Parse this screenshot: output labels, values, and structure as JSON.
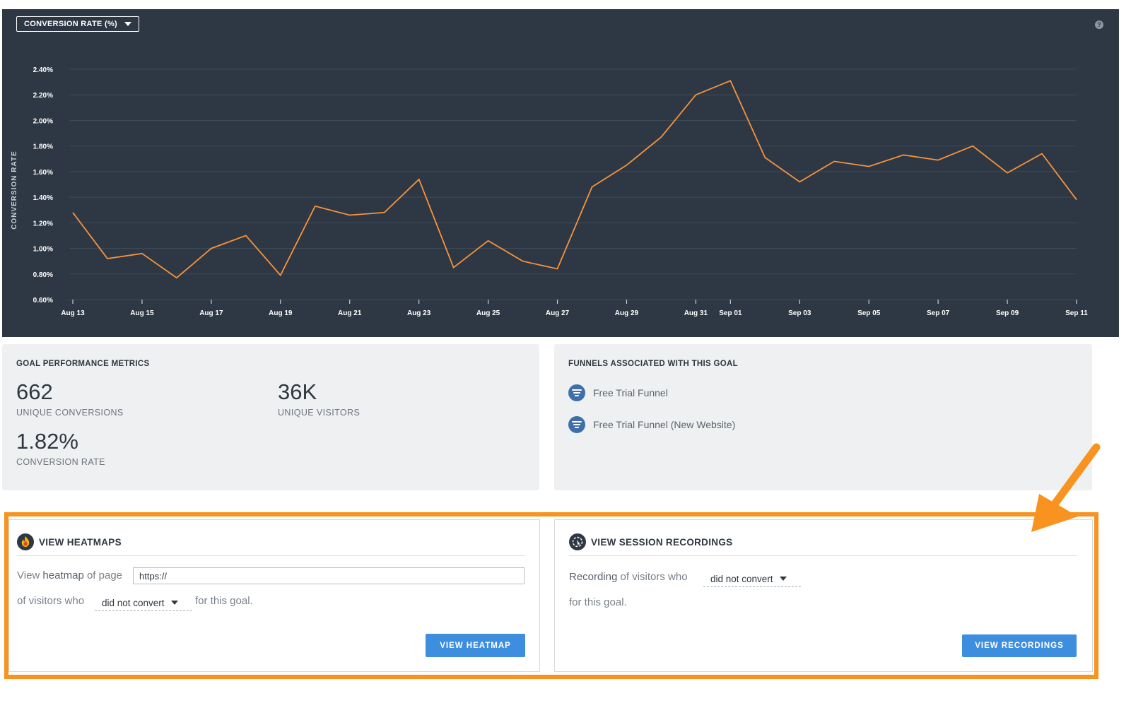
{
  "chart": {
    "metric_selector": "CONVERSION RATE (%)",
    "help_icon": "question-icon"
  },
  "chart_data": {
    "type": "line",
    "title": "",
    "ylabel": "CONVERSION RATE",
    "xlabel": "",
    "grid": true,
    "line_color": "#f7923c",
    "ylim": [
      0.6,
      2.4
    ],
    "ytick_labels": [
      "0.60%",
      "0.80%",
      "1.00%",
      "1.20%",
      "1.40%",
      "1.60%",
      "1.80%",
      "2.00%",
      "2.20%",
      "2.40%"
    ],
    "xtick_labels": [
      "Aug 13",
      "Aug 15",
      "Aug 17",
      "Aug 19",
      "Aug 21",
      "Aug 23",
      "Aug 25",
      "Aug 27",
      "Aug 29",
      "Aug 31",
      "Sep 01",
      "Sep 03",
      "Sep 05",
      "Sep 07",
      "Sep 09",
      "Sep 11"
    ],
    "x": [
      "Aug 13",
      "Aug 14",
      "Aug 15",
      "Aug 16",
      "Aug 17",
      "Aug 18",
      "Aug 19",
      "Aug 20",
      "Aug 21",
      "Aug 22",
      "Aug 23",
      "Aug 24",
      "Aug 25",
      "Aug 26",
      "Aug 27",
      "Aug 28",
      "Aug 29",
      "Aug 30",
      "Aug 31",
      "Sep 01",
      "Sep 02",
      "Sep 03",
      "Sep 04",
      "Sep 05",
      "Sep 06",
      "Sep 07",
      "Sep 08",
      "Sep 09",
      "Sep 10",
      "Sep 11"
    ],
    "series": [
      {
        "values": [
          1.28,
          0.92,
          0.96,
          0.77,
          1.0,
          1.1,
          0.79,
          1.33,
          1.26,
          1.28,
          1.54,
          0.85,
          1.06,
          0.9,
          0.84,
          1.48,
          1.65,
          1.87,
          2.2,
          2.31,
          1.71,
          1.52,
          1.68,
          1.64,
          1.73,
          1.69,
          1.8,
          1.59,
          1.74,
          1.38
        ]
      }
    ]
  },
  "metrics_card": {
    "title": "GOAL PERFORMANCE METRICS",
    "items": [
      {
        "value": "662",
        "label": "UNIQUE CONVERSIONS"
      },
      {
        "value": "36K",
        "label": "UNIQUE VISITORS"
      },
      {
        "value": "1.82%",
        "label": "CONVERSION RATE"
      }
    ]
  },
  "funnels_card": {
    "title": "FUNNELS ASSOCIATED WITH THIS GOAL",
    "items": [
      {
        "label": "Free Trial Funnel",
        "icon": "funnel-icon"
      },
      {
        "label": "Free Trial Funnel (New Website)",
        "icon": "funnel-icon"
      }
    ]
  },
  "heatmaps": {
    "title": "VIEW HEATMAPS",
    "icon": "heatmap-flame-icon",
    "text_prefix_1": "View",
    "text_bold_1": "heatmap",
    "text_prefix_2": "of page",
    "url_value": "https://",
    "line2_prefix": "of visitors who",
    "select_value": "did not convert",
    "line2_suffix": "for this goal.",
    "button": "VIEW HEATMAP"
  },
  "recordings": {
    "title": "VIEW SESSION RECORDINGS",
    "icon": "session-recording-icon",
    "text_bold": "Recording",
    "text_rest": "of visitors who",
    "select_value": "did not convert",
    "line2": "for this goal.",
    "button": "VIEW RECORDINGS"
  },
  "annotation": {
    "highlight_color": "#f7931e",
    "arrow": "arrow-pointer"
  }
}
